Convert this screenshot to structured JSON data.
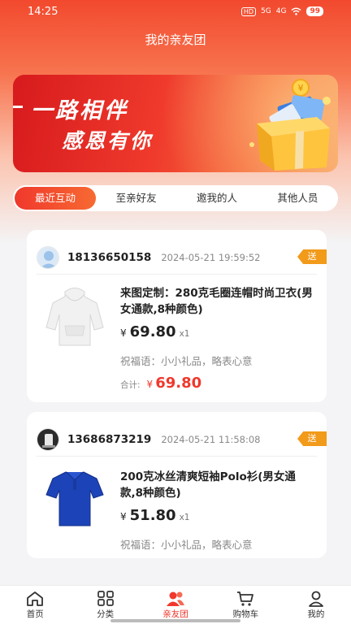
{
  "status_bar": {
    "time": "14:25",
    "signal_1": "5G",
    "signal_2": "4G",
    "battery": "99"
  },
  "header": {
    "title": "我的亲友团"
  },
  "banner": {
    "line1": "一路相伴",
    "line2": "感恩有你"
  },
  "tabs": [
    {
      "label": "最近互动",
      "active": true
    },
    {
      "label": "至亲好友",
      "active": false
    },
    {
      "label": "邀我的人",
      "active": false
    },
    {
      "label": "其他人员",
      "active": false
    }
  ],
  "records": [
    {
      "phone": "18136650158",
      "time": "2024-05-21 19:59:52",
      "badge": "送",
      "product_name": "来图定制：280克毛圈连帽时尚卫衣(男女通款,8种颜色)",
      "currency": "¥",
      "price": "69.80",
      "qty": "x1",
      "blessing": "祝福语：小小礼品，略表心意",
      "total_label": "合计:",
      "total": "69.80"
    },
    {
      "phone": "13686873219",
      "time": "2024-05-21 11:58:08",
      "badge": "送",
      "product_name": "200克冰丝清爽短袖Polo衫(男女通款,8种颜色)",
      "currency": "¥",
      "price": "51.80",
      "qty": "x1",
      "blessing": "祝福语：小小礼品，略表心意"
    }
  ],
  "bottom_nav": [
    {
      "label": "首页",
      "icon": "home-icon"
    },
    {
      "label": "分类",
      "icon": "grid-icon"
    },
    {
      "label": "亲友团",
      "icon": "friends-icon",
      "active": true
    },
    {
      "label": "购物车",
      "icon": "cart-icon"
    },
    {
      "label": "我的",
      "icon": "user-icon"
    }
  ],
  "colors": {
    "accent": "#f0382c",
    "badge": "#f29a1a"
  }
}
